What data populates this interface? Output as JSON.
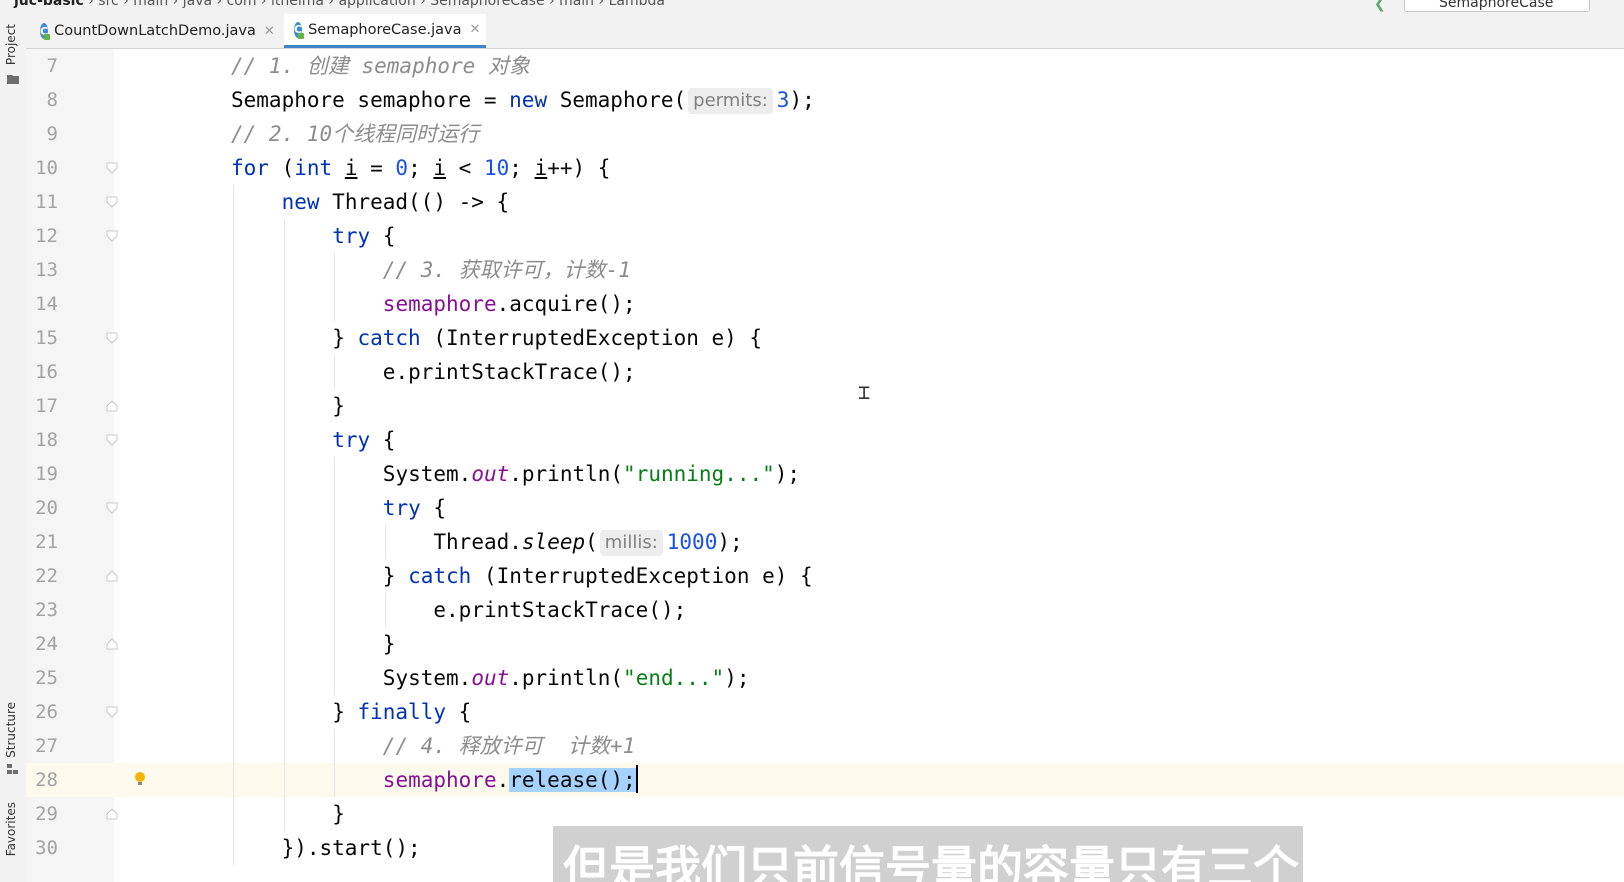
{
  "breadcrumb": {
    "project": "juc-basic",
    "path": [
      "src",
      "main",
      "java",
      "com",
      "itheima",
      "application",
      "SemaphoreCase",
      "main",
      "Lambda"
    ]
  },
  "run_config": {
    "label": "SemaphoreCase"
  },
  "tool_windows": {
    "project": "Project",
    "structure": "Structure",
    "favorites": "Favorites"
  },
  "tabs": [
    {
      "label": "CountDownLatchDemo.java",
      "active": false
    },
    {
      "label": "SemaphoreCase.java",
      "active": true
    }
  ],
  "editor": {
    "current_line": 28,
    "lines": [
      {
        "n": "7",
        "indent": 0,
        "segs": [
          [
            "cmt",
            "// 1. 创建 semaphore 对象"
          ]
        ]
      },
      {
        "n": "8",
        "indent": 0,
        "segs": [
          [
            "",
            "Semaphore semaphore = "
          ],
          [
            "kw",
            "new"
          ],
          [
            "",
            " Semaphore("
          ],
          [
            "hint",
            "permits:"
          ],
          [
            "num",
            "3"
          ],
          [
            "",
            ");"
          ]
        ]
      },
      {
        "n": "9",
        "indent": 0,
        "segs": [
          [
            "cmt",
            "// 2. 10个线程同时运行"
          ]
        ]
      },
      {
        "n": "10",
        "indent": 0,
        "segs": [
          [
            "kw",
            "for"
          ],
          [
            "",
            " ("
          ],
          [
            "kw",
            "int"
          ],
          [
            "",
            " "
          ],
          [
            "under",
            "i"
          ],
          [
            "",
            " = "
          ],
          [
            "num",
            "0"
          ],
          [
            "",
            "; "
          ],
          [
            "under",
            "i"
          ],
          [
            "",
            " < "
          ],
          [
            "num",
            "10"
          ],
          [
            "",
            "; "
          ],
          [
            "under",
            "i"
          ],
          [
            "",
            "++) {"
          ]
        ]
      },
      {
        "n": "11",
        "indent": 1,
        "segs": [
          [
            "kw",
            "new"
          ],
          [
            "",
            " Thread(() -> {"
          ]
        ]
      },
      {
        "n": "12",
        "indent": 2,
        "segs": [
          [
            "kw",
            "try"
          ],
          [
            "",
            " {"
          ]
        ]
      },
      {
        "n": "13",
        "indent": 3,
        "segs": [
          [
            "cmt",
            "// 3. 获取许可，计数-1"
          ]
        ]
      },
      {
        "n": "14",
        "indent": 3,
        "segs": [
          [
            "fld",
            "semaphore"
          ],
          [
            "",
            ".acquire();"
          ]
        ]
      },
      {
        "n": "15",
        "indent": 2,
        "segs": [
          [
            "",
            "} "
          ],
          [
            "kw",
            "catch"
          ],
          [
            "",
            " (InterruptedException e) {"
          ]
        ]
      },
      {
        "n": "16",
        "indent": 3,
        "segs": [
          [
            "",
            "e.printStackTrace();"
          ]
        ]
      },
      {
        "n": "17",
        "indent": 2,
        "segs": [
          [
            "",
            "}"
          ]
        ]
      },
      {
        "n": "18",
        "indent": 2,
        "segs": [
          [
            "kw",
            "try"
          ],
          [
            "",
            " {"
          ]
        ]
      },
      {
        "n": "19",
        "indent": 3,
        "segs": [
          [
            "",
            "System."
          ],
          [
            "stat",
            "out"
          ],
          [
            "",
            ".println("
          ],
          [
            "str",
            "\"running...\""
          ],
          [
            "",
            ");"
          ]
        ]
      },
      {
        "n": "20",
        "indent": 3,
        "segs": [
          [
            "kw",
            "try"
          ],
          [
            "",
            " {"
          ]
        ]
      },
      {
        "n": "21",
        "indent": 4,
        "segs": [
          [
            "",
            "Thread."
          ],
          [
            "statm",
            "sleep"
          ],
          [
            "",
            "("
          ],
          [
            "hint",
            "millis:"
          ],
          [
            "num",
            "1000"
          ],
          [
            "",
            ");"
          ]
        ]
      },
      {
        "n": "22",
        "indent": 3,
        "segs": [
          [
            "",
            "} "
          ],
          [
            "kw",
            "catch"
          ],
          [
            "",
            " (InterruptedException e) {"
          ]
        ]
      },
      {
        "n": "23",
        "indent": 4,
        "segs": [
          [
            "",
            "e.printStackTrace();"
          ]
        ]
      },
      {
        "n": "24",
        "indent": 3,
        "segs": [
          [
            "",
            "}"
          ]
        ]
      },
      {
        "n": "25",
        "indent": 3,
        "segs": [
          [
            "",
            "System."
          ],
          [
            "stat",
            "out"
          ],
          [
            "",
            ".println("
          ],
          [
            "str",
            "\"end...\""
          ],
          [
            "",
            ");"
          ]
        ]
      },
      {
        "n": "26",
        "indent": 2,
        "segs": [
          [
            "",
            "} "
          ],
          [
            "kw",
            "finally"
          ],
          [
            "",
            " {"
          ]
        ]
      },
      {
        "n": "27",
        "indent": 3,
        "segs": [
          [
            "cmt",
            "// 4. 释放许可  计数+1"
          ]
        ]
      },
      {
        "n": "28",
        "indent": 3,
        "segs": [
          [
            "fld",
            "semaphore"
          ],
          [
            "",
            "."
          ],
          [
            "sel",
            "release();"
          ],
          [
            "caret",
            ""
          ]
        ]
      },
      {
        "n": "29",
        "indent": 2,
        "segs": [
          [
            "",
            "}"
          ]
        ]
      },
      {
        "n": "30",
        "indent": 1,
        "segs": [
          [
            "",
            "}).start();"
          ]
        ]
      }
    ]
  },
  "subtitle": "但是我们只前信号量的容量只有三个"
}
